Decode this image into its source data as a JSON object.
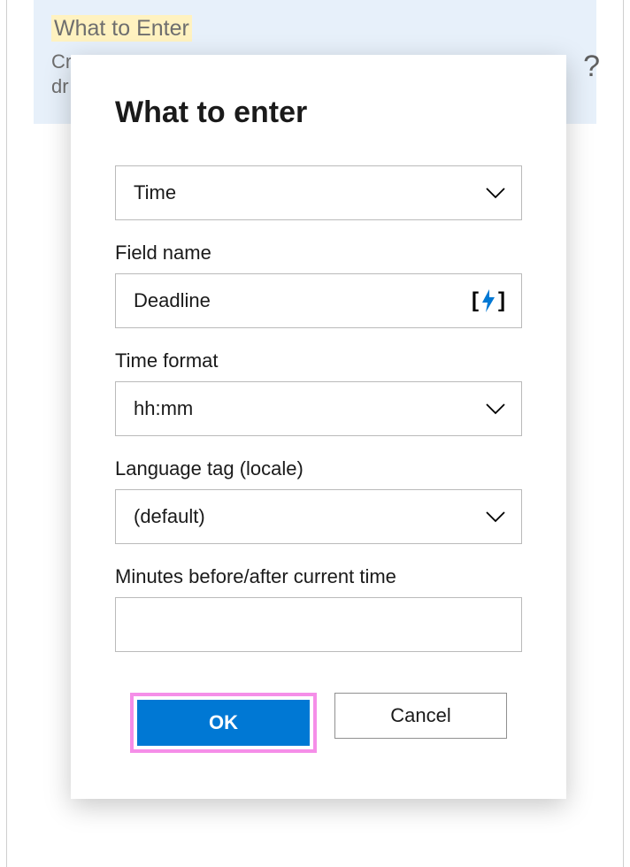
{
  "background": {
    "highlighted_title": "What to Enter",
    "subtext_left": "Cr",
    "subtext_line2": "dr",
    "help": "?"
  },
  "modal": {
    "title": "What to enter",
    "type_select": {
      "value": "Time"
    },
    "field_name": {
      "label": "Field name",
      "value": "Deadline"
    },
    "time_format": {
      "label": "Time format",
      "value": "hh:mm"
    },
    "locale": {
      "label": "Language tag (locale)",
      "value": "(default)"
    },
    "minutes_offset": {
      "label": "Minutes before/after current time",
      "value": ""
    },
    "buttons": {
      "ok": "OK",
      "cancel": "Cancel"
    }
  }
}
